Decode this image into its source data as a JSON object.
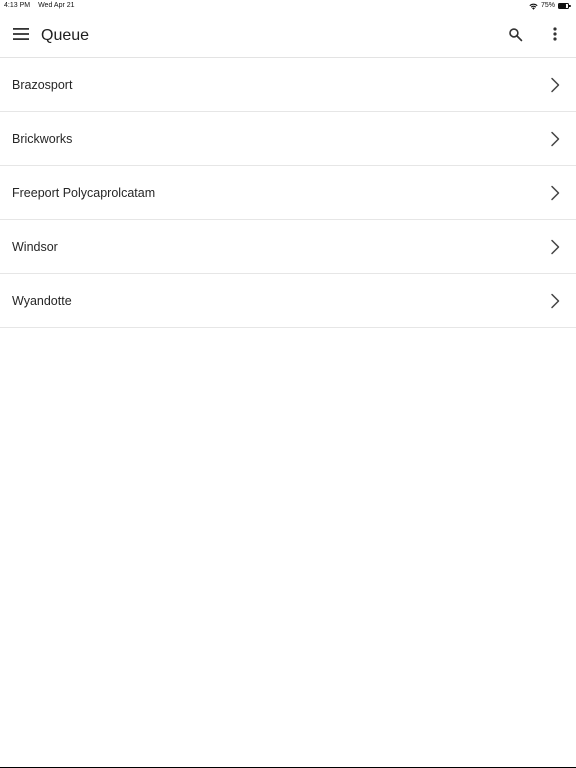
{
  "status_bar": {
    "time": "4:13 PM",
    "date": "Wed Apr 21",
    "battery_percent_label": "75%",
    "battery_level": 0.75
  },
  "app_bar": {
    "title": "Queue",
    "menu_icon": "hamburger-menu-icon",
    "search_icon": "search-icon",
    "more_icon": "more-vert-icon"
  },
  "list": {
    "items": [
      {
        "label": "Brazosport"
      },
      {
        "label": "Brickworks"
      },
      {
        "label": "Freeport Polycaprolcatam"
      },
      {
        "label": "Windsor"
      },
      {
        "label": "Wyandotte"
      }
    ],
    "chevron_icon": "chevron-right-icon"
  },
  "colors": {
    "background": "#ffffff",
    "text": "#262626",
    "divider": "#e6e6e6",
    "icon": "#333333"
  }
}
